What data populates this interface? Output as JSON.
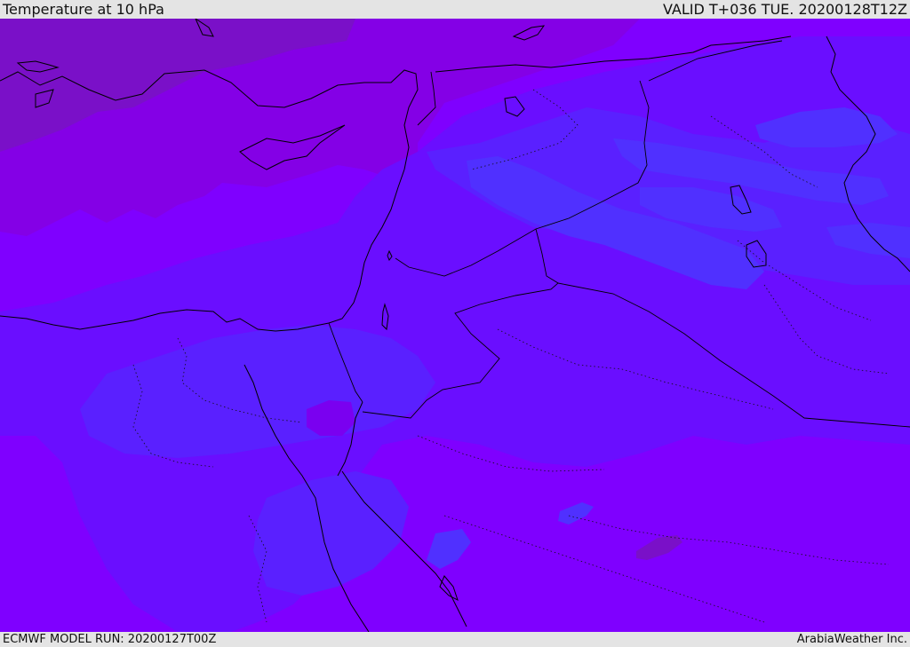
{
  "header": {
    "title": "Temperature at 10 hPa",
    "valid_time": "VALID T+036 TUE. 20200128T12Z"
  },
  "footer": {
    "model_run": "ECMWF MODEL RUN: 20200127T00Z",
    "credit": "ArabiaWeather Inc."
  },
  "colors": {
    "base_fill": "#7f00ff",
    "warm_band_1": "#8400e6",
    "warm_band_2": "#7a10c8",
    "cool_band_1": "#6a0eff",
    "cool_band_2": "#5a20ff",
    "cool_band_3": "#5030ff",
    "coastline": "#000000"
  }
}
